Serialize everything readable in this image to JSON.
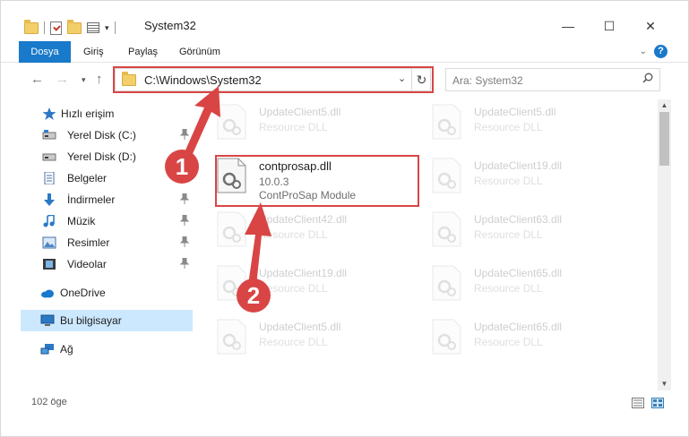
{
  "window": {
    "title": "System32",
    "minimize": "—",
    "maximize": "☐",
    "close": "✕"
  },
  "ribbon": {
    "tabs": [
      "Dosya",
      "Giriş",
      "Paylaş",
      "Görünüm"
    ]
  },
  "address": {
    "path": "C:\\Windows\\System32",
    "search_placeholder": "Ara: System32"
  },
  "sidebar": {
    "items": [
      {
        "label": "Hızlı erişim",
        "icon": "star-icon"
      },
      {
        "label": "Yerel Disk (C:)",
        "icon": "drive-icon",
        "pinned": true
      },
      {
        "label": "Yerel Disk (D:)",
        "icon": "drive-icon",
        "pinned": false
      },
      {
        "label": "Belgeler",
        "icon": "documents-icon",
        "pinned": true
      },
      {
        "label": "İndirmeler",
        "icon": "download-icon",
        "pinned": true
      },
      {
        "label": "Müzik",
        "icon": "music-icon",
        "pinned": true
      },
      {
        "label": "Resimler",
        "icon": "pictures-icon",
        "pinned": true
      },
      {
        "label": "Videolar",
        "icon": "videos-icon",
        "pinned": true
      },
      {
        "label": "OneDrive",
        "icon": "cloud-icon"
      },
      {
        "label": "Bu bilgisayar",
        "icon": "computer-icon",
        "selected": true
      },
      {
        "label": "Ağ",
        "icon": "network-icon"
      }
    ]
  },
  "files": {
    "highlighted": {
      "name": "contprosap.dll",
      "version": "10.0.3",
      "description": "ContProSap Module"
    },
    "left_column": [
      {
        "name": "UpdateClient5.dll",
        "description": "Resource DLL"
      },
      {
        "name": "UpdateClient42.dll",
        "description": "Resource DLL"
      },
      {
        "name": "UpdateClient19.dll",
        "description": "Resource DLL"
      },
      {
        "name": "UpdateClient5.dll",
        "description": "Resource DLL"
      }
    ],
    "right_column": [
      {
        "name": "UpdateClient5.dll",
        "description": "Resource DLL"
      },
      {
        "name": "UpdateClient19.dll",
        "description": "Resource DLL"
      },
      {
        "name": "UpdateClient63.dll",
        "description": "Resource DLL"
      },
      {
        "name": "UpdateClient65.dll",
        "description": "Resource DLL"
      },
      {
        "name": "UpdateClient65.dll",
        "description": "Resource DLL"
      }
    ]
  },
  "status": {
    "item_count": "102 öge"
  },
  "annotations": {
    "badge_1": "1",
    "badge_2": "2",
    "color": "#d94545"
  }
}
